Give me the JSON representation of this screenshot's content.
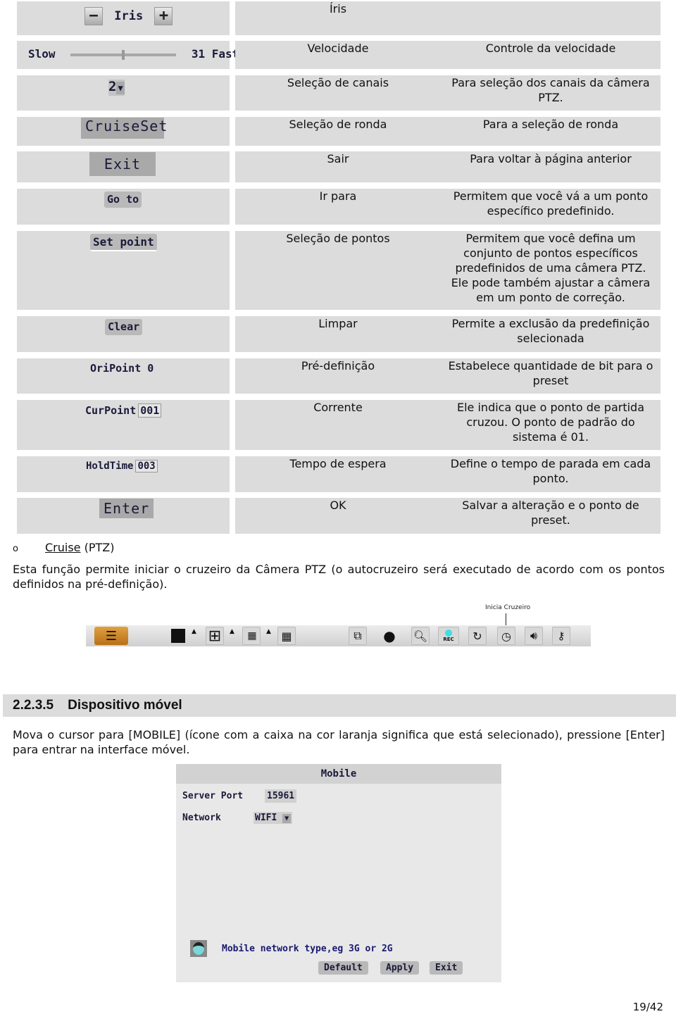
{
  "table": {
    "rows": [
      {
        "widget": {
          "type": "iris",
          "minus": "−",
          "label": "Iris",
          "plus": "+"
        },
        "function": "Íris",
        "description": ""
      },
      {
        "widget": {
          "type": "slider",
          "left": "Slow",
          "value": "31",
          "right": "Fast",
          "level": 0.5
        },
        "function": "Velocidade",
        "description": "Controle da velocidade"
      },
      {
        "widget": {
          "type": "select",
          "value": "2",
          "arrow": "▼"
        },
        "function": "Seleção de canais",
        "description": "Para seleção dos canais da câmera PTZ."
      },
      {
        "widget": {
          "type": "button",
          "label": "CruiseSet"
        },
        "function": "Seleção de ronda",
        "description": "Para a seleção de ronda"
      },
      {
        "widget": {
          "type": "button",
          "label": "Exit"
        },
        "function": "Sair",
        "description": "Para voltar à página anterior"
      },
      {
        "widget": {
          "type": "button",
          "label": "Go to"
        },
        "function": "Ir para",
        "description": "Permitem que você vá a um ponto específico predefinido."
      },
      {
        "widget": {
          "type": "button",
          "label": "Set point"
        },
        "function": "Seleção de pontos",
        "description": "Permitem que você defina um conjunto de pontos específicos predefinidos de uma câmera PTZ. Ele pode também ajustar a câmera em um ponto de correção."
      },
      {
        "widget": {
          "type": "button",
          "label": "Clear"
        },
        "function": "Limpar",
        "description": "Permite a exclusão da predefinição selecionada"
      },
      {
        "widget": {
          "type": "field",
          "label": "OriPoint",
          "value": "0"
        },
        "function": "Pré-definição",
        "description": "Estabelece quantidade de bit para o preset"
      },
      {
        "widget": {
          "type": "field",
          "label": "CurPoint",
          "value": "001"
        },
        "function": "Corrente",
        "description": "Ele indica que o ponto de partida cruzou. O ponto de padrão do sistema é 01."
      },
      {
        "widget": {
          "type": "field",
          "label": "HoldTime",
          "value": "003"
        },
        "function": "Tempo de espera",
        "description": "Define o tempo de parada em cada ponto."
      },
      {
        "widget": {
          "type": "button",
          "label": "Enter"
        },
        "function": "OK",
        "description": "Salvar a alteração e o ponto de preset."
      }
    ]
  },
  "cruise": {
    "bullet": "o",
    "title_link": "Cruise",
    "title_suffix": " (PTZ)",
    "paragraph": "Esta função permite iniciar o cruzeiro da Câmera PTZ (o autocruzeiro será executado de acordo com os pontos definidos na pré-definição)."
  },
  "toolbar": {
    "callout": "Inicia Cruzeiro",
    "icons": [
      "mobile-icon",
      "single-view-icon",
      "quad-view-icon",
      "nine-view-icon",
      "sixteen-view-icon",
      "pip-icon",
      "ptz-camera-icon",
      "search-icon",
      "record-icon",
      "playback-icon",
      "cruise-icon",
      "audio-icon",
      "lock-key-icon"
    ],
    "rec_label": "REC"
  },
  "section": {
    "number": "2.2.3.5",
    "title": "Dispositivo móvel",
    "paragraph": "Mova o cursor para [MOBILE] (ícone com a caixa na cor laranja significa que está selecionado), pressione [Enter] para entrar na interface móvel."
  },
  "mobile_dialog": {
    "title": "Mobile",
    "server_port_label": "Server Port",
    "server_port_value": "15961",
    "network_label": "Network",
    "network_value": "WIFI",
    "hint": "Mobile network type,eg 3G or 2G",
    "buttons": {
      "default": "Default",
      "apply": "Apply",
      "exit": "Exit"
    }
  },
  "footer": {
    "page": "19/42"
  }
}
